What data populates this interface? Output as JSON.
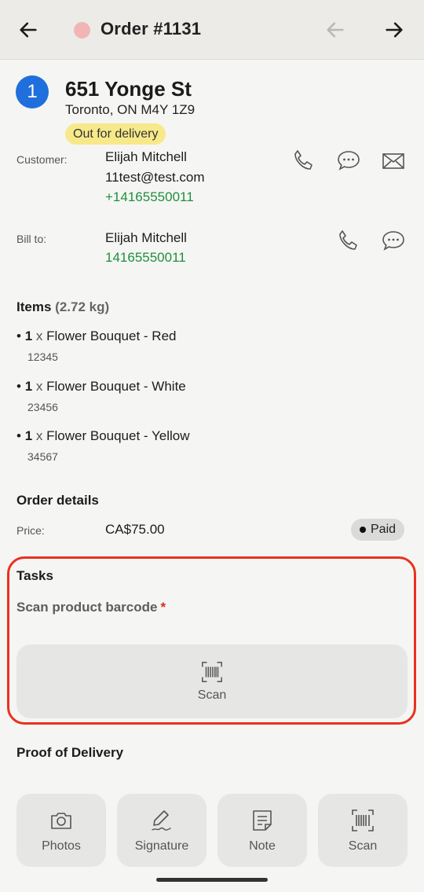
{
  "header": {
    "title": "Order #1131",
    "status_color": "#f1b6b4"
  },
  "stop": {
    "number": "1",
    "address_line1": "651 Yonge St",
    "address_line2": "Toronto, ON M4Y 1Z9",
    "status": "Out for delivery"
  },
  "customer": {
    "label": "Customer:",
    "name": "Elijah Mitchell",
    "email": "11test@test.com",
    "phone": "+14165550011"
  },
  "bill_to": {
    "label": "Bill to:",
    "name": "Elijah Mitchell",
    "phone": "14165550011"
  },
  "items": {
    "heading": "Items",
    "weight": "(2.72 kg)",
    "list": [
      {
        "qty": "1",
        "x": "x",
        "name": "Flower Bouquet - Red",
        "sku": "12345"
      },
      {
        "qty": "1",
        "x": "x",
        "name": "Flower Bouquet - White",
        "sku": "23456"
      },
      {
        "qty": "1",
        "x": "x",
        "name": "Flower Bouquet - Yellow",
        "sku": "34567"
      }
    ]
  },
  "order_details": {
    "heading": "Order details",
    "price_label": "Price:",
    "price_value": "CA$75.00",
    "payment_status": "Paid"
  },
  "tasks": {
    "heading": "Tasks",
    "task_label": "Scan product barcode",
    "required_mark": "*",
    "scan_label": "Scan",
    "highlight_color": "#e8321f"
  },
  "proof": {
    "heading": "Proof of Delivery",
    "actions": [
      {
        "label": "Photos",
        "icon": "camera-icon"
      },
      {
        "label": "Signature",
        "icon": "pen-icon"
      },
      {
        "label": "Note",
        "icon": "note-icon"
      },
      {
        "label": "Scan",
        "icon": "barcode-icon"
      }
    ]
  },
  "colors": {
    "accent_blue": "#1f6fdc",
    "phone_green": "#1f8f3c",
    "status_yellow": "#f7e98a"
  }
}
